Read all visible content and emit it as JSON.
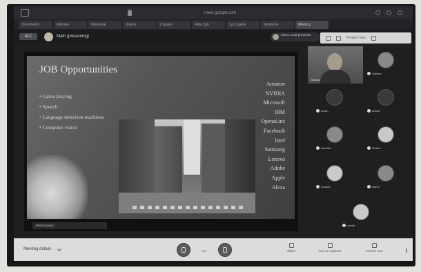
{
  "browser": {
    "url": "meet.google.com",
    "tabs": [
      "Documents",
      "Website",
      "Notebook",
      "Videos",
      "Classes",
      "Ride Cab",
      "Lyric game",
      "Notebook",
      "Meeting"
    ]
  },
  "meeting": {
    "record_badge": "REC",
    "presenting_label": "Math (presenting)",
    "presenter_pill": "Minoo Lead presenter",
    "overlay_toolbar_label": "Present now",
    "caption_tag": "Jessica (you)"
  },
  "slide": {
    "title": "JOB Opportunities",
    "bullets": [
      "Game playing",
      "Speech",
      "Language detection machines",
      "Computer vision"
    ],
    "companies": [
      "Amazon",
      "NVIDIA",
      "Microsoft",
      "IBM",
      "Openai.inc",
      "Facebook",
      "Intel",
      "Samsung",
      "Lenovo",
      "Adobe",
      "Apple",
      "Alexa"
    ]
  },
  "participants": {
    "self_name": "Jessica",
    "others": [
      "Jessica",
      "Aman",
      "Arman",
      "Nandita",
      "Shikha",
      "Kundan",
      "Harsh",
      "Ankita",
      "Santosh",
      "Pranav"
    ]
  },
  "bottombar": {
    "meeting_details": "Meeting details",
    "actions": [
      "Share",
      "Turn on captions",
      "Present now"
    ]
  }
}
